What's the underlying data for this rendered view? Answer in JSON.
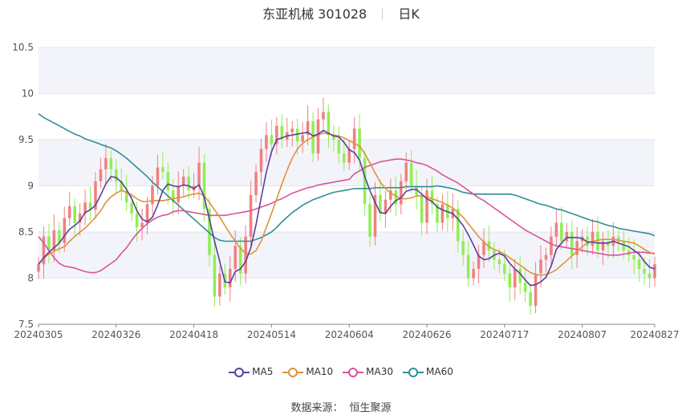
{
  "title": {
    "stock": "东亚机械 301028",
    "period": "日K"
  },
  "source": {
    "label": "数据来源：",
    "value": "恒生聚源"
  },
  "colors": {
    "up": "#f08080",
    "down": "#90ee55",
    "MA5": "#5b3f9c",
    "MA10": "#e0913a",
    "MA30": "#d9549b",
    "MA60": "#2e8f97",
    "band": "#f3f4fa"
  },
  "chart_data": {
    "type": "candlestick",
    "y_axis": {
      "min": 7.5,
      "max": 10.5,
      "ticks": [
        "7.5",
        "8",
        "8.5",
        "9",
        "9.5",
        "10",
        "10.5"
      ]
    },
    "x_axis": {
      "tick_labels": [
        "20240305",
        "20240326",
        "20240418",
        "20240514",
        "20240604",
        "20240626",
        "20240717",
        "20240807",
        "20240827"
      ],
      "tick_index": [
        0,
        15,
        30,
        45,
        60,
        75,
        90,
        105,
        119
      ]
    },
    "legend": [
      "MA5",
      "MA10",
      "MA30",
      "MA60"
    ],
    "closes": [
      8.15,
      8.45,
      8.3,
      8.52,
      8.38,
      8.65,
      8.78,
      8.6,
      8.7,
      8.82,
      8.74,
      9.05,
      9.18,
      9.3,
      9.18,
      9.05,
      8.95,
      8.82,
      8.7,
      8.55,
      8.6,
      8.8,
      9.0,
      9.2,
      9.15,
      8.95,
      8.82,
      9.0,
      9.1,
      8.95,
      9.0,
      9.25,
      8.75,
      8.25,
      7.8,
      8.05,
      7.9,
      8.1,
      8.35,
      8.05,
      8.45,
      8.9,
      9.15,
      9.4,
      9.55,
      9.45,
      9.65,
      9.5,
      9.58,
      9.62,
      9.48,
      9.55,
      9.7,
      9.35,
      9.72,
      9.8,
      9.55,
      9.5,
      9.35,
      9.25,
      9.4,
      9.62,
      9.3,
      8.8,
      8.45,
      8.9,
      8.7,
      8.85,
      8.95,
      8.8,
      9.05,
      9.25,
      9.0,
      8.9,
      8.6,
      8.95,
      8.8,
      8.6,
      8.8,
      8.65,
      8.75,
      8.4,
      8.25,
      8.0,
      8.1,
      8.25,
      8.4,
      8.3,
      8.2,
      8.15,
      8.05,
      7.9,
      8.1,
      7.95,
      7.85,
      7.7,
      8.05,
      8.2,
      8.25,
      8.45,
      8.6,
      8.4,
      8.5,
      8.25,
      8.4,
      8.45,
      8.35,
      8.5,
      8.3,
      8.4,
      8.35,
      8.45,
      8.4,
      8.3,
      8.25,
      8.2,
      8.1,
      8.05,
      8.0,
      8.15
    ],
    "MA5": [
      8.15,
      8.22,
      8.28,
      8.33,
      8.38,
      8.46,
      8.53,
      8.57,
      8.62,
      8.71,
      8.74,
      8.79,
      8.9,
      9.02,
      9.1,
      9.09,
      9.04,
      8.96,
      8.86,
      8.73,
      8.64,
      8.61,
      8.66,
      8.79,
      8.95,
      9.02,
      9.0,
      8.99,
      9.01,
      9.0,
      8.97,
      9.01,
      8.88,
      8.64,
      8.4,
      8.18,
      7.96,
      7.95,
      8.07,
      8.1,
      8.18,
      8.33,
      8.58,
      8.87,
      9.15,
      9.37,
      9.5,
      9.52,
      9.54,
      9.55,
      9.56,
      9.57,
      9.58,
      9.54,
      9.56,
      9.6,
      9.57,
      9.54,
      9.53,
      9.47,
      9.39,
      9.36,
      9.28,
      9.1,
      8.95,
      8.82,
      8.71,
      8.7,
      8.78,
      8.84,
      8.87,
      8.94,
      8.96,
      8.96,
      8.91,
      8.86,
      8.83,
      8.77,
      8.74,
      8.72,
      8.7,
      8.64,
      8.57,
      8.47,
      8.36,
      8.24,
      8.2,
      8.21,
      8.25,
      8.27,
      8.24,
      8.16,
      8.1,
      8.05,
      7.98,
      7.92,
      7.93,
      7.96,
      8.01,
      8.13,
      8.31,
      8.38,
      8.44,
      8.44,
      8.44,
      8.43,
      8.39,
      8.39,
      8.38,
      8.38,
      8.38,
      8.4,
      8.38,
      8.36,
      8.34,
      8.3,
      8.26,
      8.18,
      8.12,
      8.1
    ],
    "MA10": [
      8.15,
      8.22,
      8.26,
      8.29,
      8.32,
      8.34,
      8.4,
      8.45,
      8.5,
      8.54,
      8.6,
      8.66,
      8.73,
      8.82,
      8.88,
      8.92,
      8.95,
      8.93,
      8.9,
      8.86,
      8.83,
      8.83,
      8.84,
      8.84,
      8.84,
      8.85,
      8.86,
      8.87,
      8.88,
      8.9,
      8.91,
      8.92,
      8.89,
      8.82,
      8.74,
      8.66,
      8.57,
      8.48,
      8.4,
      8.32,
      8.27,
      8.26,
      8.3,
      8.4,
      8.55,
      8.7,
      8.86,
      9.02,
      9.17,
      9.3,
      9.4,
      9.46,
      9.5,
      9.53,
      9.55,
      9.57,
      9.56,
      9.55,
      9.54,
      9.52,
      9.49,
      9.46,
      9.43,
      9.35,
      9.25,
      9.14,
      9.04,
      8.97,
      8.92,
      8.89,
      8.86,
      8.86,
      8.87,
      8.89,
      8.89,
      8.88,
      8.86,
      8.84,
      8.82,
      8.79,
      8.76,
      8.71,
      8.66,
      8.59,
      8.52,
      8.45,
      8.39,
      8.34,
      8.31,
      8.29,
      8.26,
      8.22,
      8.18,
      8.14,
      8.1,
      8.06,
      8.04,
      8.03,
      8.04,
      8.06,
      8.09,
      8.14,
      8.19,
      8.24,
      8.29,
      8.34,
      8.38,
      8.4,
      8.41,
      8.42,
      8.42,
      8.42,
      8.41,
      8.4,
      8.39,
      8.38,
      8.35,
      8.31,
      8.28,
      8.26
    ],
    "MA30": [
      8.45,
      8.38,
      8.3,
      8.22,
      8.16,
      8.13,
      8.12,
      8.11,
      8.09,
      8.07,
      8.06,
      8.06,
      8.08,
      8.12,
      8.16,
      8.2,
      8.27,
      8.33,
      8.41,
      8.48,
      8.54,
      8.59,
      8.63,
      8.66,
      8.68,
      8.69,
      8.72,
      8.73,
      8.73,
      8.72,
      8.71,
      8.7,
      8.69,
      8.68,
      8.68,
      8.68,
      8.68,
      8.69,
      8.7,
      8.71,
      8.72,
      8.73,
      8.75,
      8.77,
      8.79,
      8.81,
      8.84,
      8.86,
      8.89,
      8.92,
      8.94,
      8.96,
      8.98,
      8.99,
      9.01,
      9.02,
      9.03,
      9.04,
      9.05,
      9.06,
      9.07,
      9.13,
      9.16,
      9.2,
      9.22,
      9.24,
      9.26,
      9.27,
      9.28,
      9.29,
      9.29,
      9.28,
      9.27,
      9.25,
      9.24,
      9.22,
      9.19,
      9.16,
      9.12,
      9.09,
      9.06,
      9.03,
      8.99,
      8.95,
      8.91,
      8.87,
      8.84,
      8.8,
      8.76,
      8.72,
      8.68,
      8.64,
      8.6,
      8.56,
      8.52,
      8.49,
      8.46,
      8.43,
      8.4,
      8.37,
      8.35,
      8.34,
      8.33,
      8.32,
      8.31,
      8.3,
      8.29,
      8.28,
      8.27,
      8.26,
      8.25,
      8.25,
      8.25,
      8.26,
      8.27,
      8.28,
      8.28,
      8.28,
      8.27,
      8.27
    ],
    "MA60": [
      9.78,
      9.74,
      9.71,
      9.68,
      9.65,
      9.62,
      9.59,
      9.56,
      9.54,
      9.51,
      9.49,
      9.47,
      9.45,
      9.43,
      9.41,
      9.38,
      9.34,
      9.3,
      9.25,
      9.2,
      9.15,
      9.1,
      9.04,
      8.99,
      8.94,
      8.89,
      8.84,
      8.79,
      8.74,
      8.69,
      8.64,
      8.59,
      8.54,
      8.49,
      8.44,
      8.41,
      8.4,
      8.4,
      8.4,
      8.4,
      8.4,
      8.4,
      8.42,
      8.44,
      8.47,
      8.5,
      8.55,
      8.61,
      8.66,
      8.71,
      8.75,
      8.79,
      8.82,
      8.85,
      8.87,
      8.89,
      8.91,
      8.93,
      8.94,
      8.95,
      8.96,
      8.97,
      8.97,
      8.97,
      8.97,
      8.98,
      8.98,
      8.98,
      8.98,
      8.98,
      8.98,
      8.99,
      8.99,
      8.99,
      8.99,
      8.99,
      8.99,
      9.0,
      8.99,
      8.98,
      8.97,
      8.95,
      8.93,
      8.92,
      8.91,
      8.91,
      8.91,
      8.91,
      8.91,
      8.91,
      8.91,
      8.91,
      8.9,
      8.88,
      8.86,
      8.84,
      8.82,
      8.8,
      8.79,
      8.77,
      8.75,
      8.74,
      8.72,
      8.7,
      8.68,
      8.66,
      8.64,
      8.62,
      8.61,
      8.59,
      8.57,
      8.56,
      8.54,
      8.53,
      8.52,
      8.51,
      8.5,
      8.49,
      8.48,
      8.46
    ]
  }
}
